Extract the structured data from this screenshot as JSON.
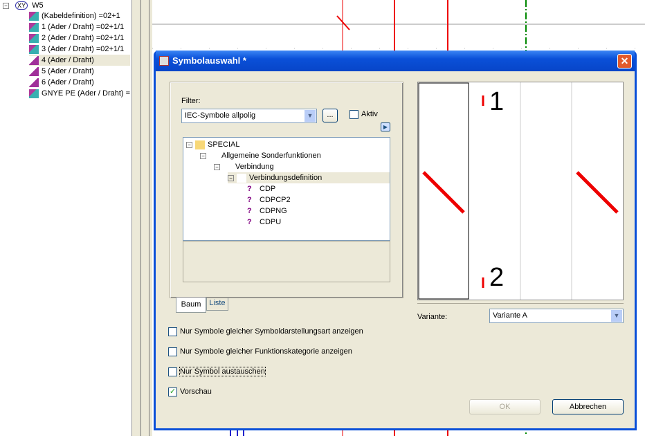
{
  "left_tree": {
    "root": "W5",
    "root_badge": "XY",
    "items": [
      {
        "label": "(Kabeldefinition) =02+1"
      },
      {
        "label": "1 (Ader / Draht) =02+1/1"
      },
      {
        "label": "2 (Ader / Draht) =02+1/1"
      },
      {
        "label": "3 (Ader / Draht) =02+1/1"
      },
      {
        "label": "4 (Ader / Draht)"
      },
      {
        "label": "5 (Ader / Draht)"
      },
      {
        "label": "6 (Ader / Draht)"
      },
      {
        "label": "GNYE PE (Ader / Draht) ="
      }
    ]
  },
  "dialog": {
    "title": "Symbolauswahl *",
    "filter_label": "Filter:",
    "filter_value": "IEC-Symbole allpolig",
    "ellipsis": "...",
    "aktiv_label": "Aktiv",
    "tree": [
      "SPECIAL",
      "Allgemeine Sonderfunktionen",
      "Verbindung",
      "Verbindungsdefinition",
      "CDP",
      "CDPCP2",
      "CDPNG",
      "CDPU"
    ],
    "tabs": [
      "Baum",
      "Liste"
    ],
    "options": [
      {
        "label": "Nur Symbole gleicher Symboldarstellungsart anzeigen",
        "checked": false
      },
      {
        "label": "Nur Symbole gleicher Funktionskategorie anzeigen",
        "checked": false
      },
      {
        "label": "Nur Symbol austauschen",
        "checked": false
      },
      {
        "label": "Vorschau",
        "checked": true
      }
    ],
    "preview_labels": [
      "1",
      "2"
    ],
    "variante_label": "Variante:",
    "variante_value": "Variante A",
    "ok": "OK",
    "cancel": "Abbrechen"
  },
  "colors": {
    "accent": "#0a4fd8",
    "wire": "#e00000",
    "ground": "#008000"
  }
}
